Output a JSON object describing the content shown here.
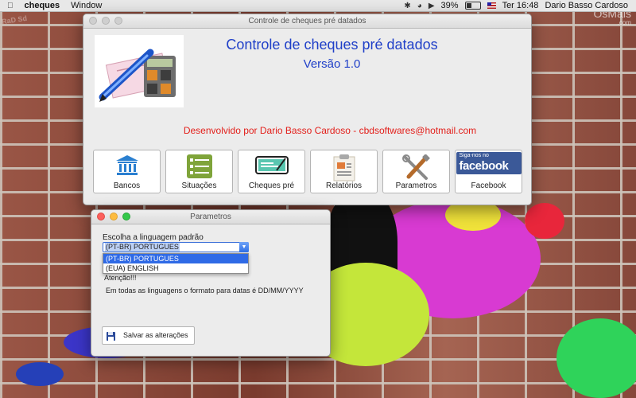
{
  "menubar": {
    "apple_icon": "apple-icon",
    "app_name": "cheques",
    "menu_window": "Window",
    "battery_percent": "39%",
    "clock": "Ter 16:48",
    "user": "Dario Basso Cardoso"
  },
  "wallpaper": {
    "watermark_main": "OsMais",
    "watermark_sub": ".com",
    "wall_logo": "RaD Sd"
  },
  "main_window": {
    "title": "Controle de cheques pré datados",
    "app_title": "Controle de cheques pré datados",
    "version": "Versão 1.0",
    "credit": "Desenvolvido por Dario Basso Cardoso - cbdsoftwares@hotmail.com",
    "buttons": [
      {
        "label": "Bancos",
        "icon": "bank-icon"
      },
      {
        "label": "Situações",
        "icon": "list-icon"
      },
      {
        "label": "Cheques pré",
        "icon": "cheque-icon"
      },
      {
        "label": "Relatórios",
        "icon": "report-icon"
      },
      {
        "label": "Parametros",
        "icon": "tools-icon"
      },
      {
        "label": "Facebook",
        "icon": "facebook-icon",
        "badge_small": "Siga-nos no",
        "badge_big": "facebook"
      }
    ]
  },
  "params_window": {
    "title": "Parametros",
    "choose_label": "Escolha a linguagem padrão",
    "selected_value": "(PT-BR) PORTUGUES",
    "options": [
      "(PT-BR) PORTUGUES",
      "(EUA) ENGLISH"
    ],
    "attention": "Atenção!!!",
    "date_note": "Em todas as linguagens o formato para datas é DD/MM/YYYY",
    "save_label": "Salvar as alterações"
  },
  "colors": {
    "title_blue": "#1f3fc8",
    "credit_red": "#e3201b",
    "selection_blue": "#2f6ae6",
    "facebook_blue": "#3b5998"
  }
}
